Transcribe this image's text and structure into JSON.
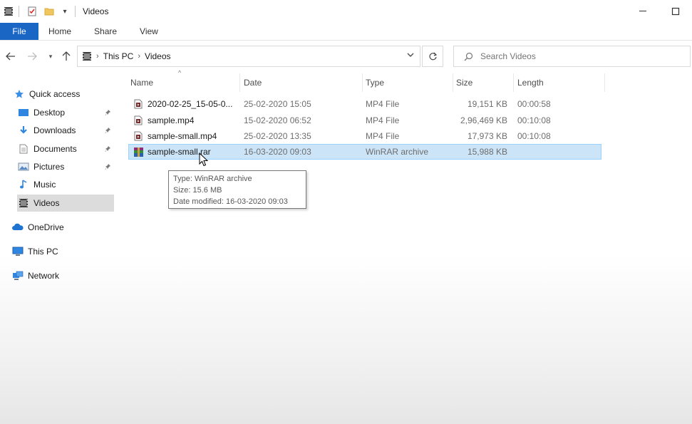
{
  "window": {
    "title": "Videos",
    "controls": {
      "minimize": "—",
      "maximize": "☐"
    }
  },
  "ribbon": {
    "tabs": [
      "File",
      "Home",
      "Share",
      "View"
    ]
  },
  "address": {
    "crumbs": [
      "This PC",
      "Videos"
    ],
    "search_placeholder": "Search Videos"
  },
  "nav": {
    "items": [
      {
        "label": "Quick access",
        "icon": "star-icon"
      },
      {
        "label": "Desktop",
        "icon": "desktop-icon",
        "pinned": true
      },
      {
        "label": "Downloads",
        "icon": "download-icon",
        "pinned": true
      },
      {
        "label": "Documents",
        "icon": "document-icon",
        "pinned": true
      },
      {
        "label": "Pictures",
        "icon": "pictures-icon",
        "pinned": true
      },
      {
        "label": "Music",
        "icon": "music-icon"
      },
      {
        "label": "Videos",
        "icon": "film-icon",
        "selected": true
      },
      {
        "label": "OneDrive",
        "icon": "cloud-icon"
      },
      {
        "label": "This PC",
        "icon": "computer-icon"
      },
      {
        "label": "Network",
        "icon": "network-icon"
      }
    ]
  },
  "columns": {
    "name": "Name",
    "date": "Date",
    "type": "Type",
    "size": "Size",
    "length": "Length"
  },
  "files": [
    {
      "name": "2020-02-25_15-05-0...",
      "date": "25-02-2020 15:05",
      "type": "MP4 File",
      "size": "19,151 KB",
      "length": "00:00:58",
      "icon": "video-file-icon"
    },
    {
      "name": "sample.mp4",
      "date": "15-02-2020 06:52",
      "type": "MP4 File",
      "size": "2,96,469 KB",
      "length": "00:10:08",
      "icon": "video-file-icon"
    },
    {
      "name": "sample-small.mp4",
      "date": "25-02-2020 13:35",
      "type": "MP4 File",
      "size": "17,973 KB",
      "length": "00:10:08",
      "icon": "video-file-icon"
    },
    {
      "name": "sample-small.rar",
      "date": "16-03-2020 09:03",
      "type": "WinRAR archive",
      "size": "15,988 KB",
      "length": "",
      "icon": "winrar-icon",
      "selected": true
    }
  ],
  "tooltip": {
    "type_line": "Type: WinRAR archive",
    "size_line": "Size: 15.6 MB",
    "date_line": "Date modified: 16-03-2020 09:03"
  },
  "colors": {
    "accent": "#1a66c4",
    "selection": "#cce4f7",
    "selection_border": "#99d1ff",
    "nav_selected": "#dcdcdc"
  }
}
